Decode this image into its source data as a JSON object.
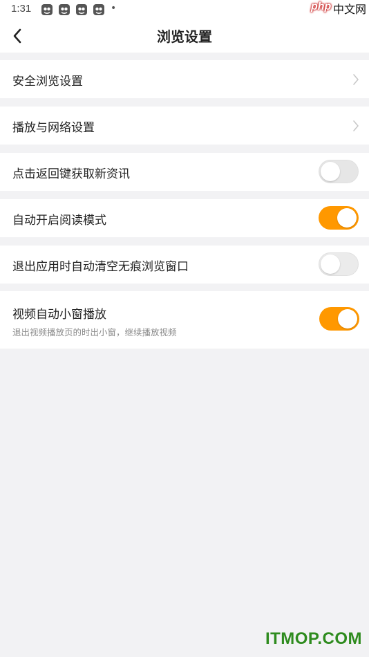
{
  "status_bar": {
    "time": "1:31",
    "notification_icons": [
      "app-notification-icon",
      "app-notification-icon",
      "app-notification-icon",
      "app-notification-icon"
    ],
    "dot": "•"
  },
  "watermark_top": {
    "php": "php",
    "cn": "中文网"
  },
  "header": {
    "back_icon": "chevron-left-icon",
    "title": "浏览设置"
  },
  "settings": [
    {
      "label": "安全浏览设置",
      "control": "chevron"
    },
    {
      "label": "播放与网络设置",
      "control": "chevron"
    },
    {
      "label": "点击返回键获取新资讯",
      "control": "toggle",
      "on": false,
      "enabled": false
    },
    {
      "label": "自动开启阅读模式",
      "control": "toggle",
      "on": true
    },
    {
      "label": "退出应用时自动清空无痕浏览窗口",
      "control": "toggle",
      "on": false
    },
    {
      "label": "视频自动小窗播放",
      "subtitle": "退出视频播放页的时出小窗，继续播放视频",
      "control": "toggle",
      "on": true
    }
  ],
  "watermark_bottom": "ITMOP.COM",
  "colors": {
    "accent": "#ff9800",
    "background": "#f2f2f4",
    "toggle_off": "#ebebeb"
  }
}
